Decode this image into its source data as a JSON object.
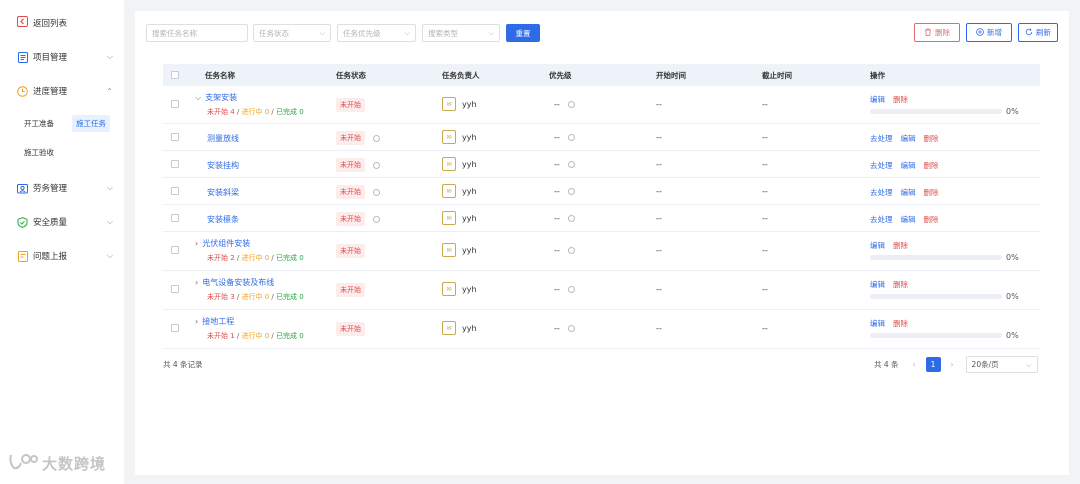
{
  "sidebar": {
    "back_label": "返回列表",
    "menus": [
      {
        "label": "项目管理",
        "icon": "document-icon"
      },
      {
        "label": "进度管理",
        "icon": "clock-icon"
      },
      {
        "label": "劳务管理",
        "icon": "worker-icon"
      },
      {
        "label": "安全质量",
        "icon": "shield-icon"
      },
      {
        "label": "问题上报",
        "icon": "report-icon"
      }
    ],
    "sub_items": [
      "开工准备",
      "施工任务",
      "施工验收"
    ]
  },
  "filters": {
    "name_placeholder": "搜索任务名称",
    "status_placeholder": "任务状态",
    "priority_placeholder": "任务优先级",
    "type_placeholder": "搜索类型",
    "reset_label": "重置"
  },
  "actions": {
    "delete_label": "删除",
    "add_label": "新增",
    "refresh_label": "刷新"
  },
  "table": {
    "headers": [
      "任务名称",
      "任务状态",
      "任务负责人",
      "优先级",
      "开始时间",
      "截止时间",
      "操作"
    ],
    "rows": [
      {
        "name": "支架安装",
        "parent": true,
        "expanded": true,
        "stats": {
          "not_started": "未开始 4",
          "in_progress": "进行中 0",
          "done": "已完成 0"
        },
        "status": "未开始",
        "owner": "yyh",
        "priority": "--",
        "start": "--",
        "end": "--",
        "ops": [
          "编辑",
          "删除"
        ],
        "progress": "0%"
      },
      {
        "name": "测量放线",
        "parent": false,
        "status": "未开始",
        "owner": "yyh",
        "priority": "--",
        "start": "--",
        "end": "--",
        "ops": [
          "去处理",
          "编辑",
          "删除"
        ]
      },
      {
        "name": "安装挂构",
        "parent": false,
        "status": "未开始",
        "owner": "yyh",
        "priority": "--",
        "start": "--",
        "end": "--",
        "ops": [
          "去处理",
          "编辑",
          "删除"
        ]
      },
      {
        "name": "安装斜梁",
        "parent": false,
        "status": "未开始",
        "owner": "yyh",
        "priority": "--",
        "start": "--",
        "end": "--",
        "ops": [
          "去处理",
          "编辑",
          "删除"
        ]
      },
      {
        "name": "安装檩条",
        "parent": false,
        "status": "未开始",
        "owner": "yyh",
        "priority": "--",
        "start": "--",
        "end": "--",
        "ops": [
          "去处理",
          "编辑",
          "删除"
        ]
      },
      {
        "name": "光伏组件安装",
        "parent": true,
        "expanded": false,
        "stats": {
          "not_started": "未开始 2",
          "in_progress": "进行中 0",
          "done": "已完成 0"
        },
        "status": "未开始",
        "owner": "yyh",
        "priority": "--",
        "start": "--",
        "end": "--",
        "ops": [
          "编辑",
          "删除"
        ],
        "progress": "0%"
      },
      {
        "name": "电气设备安装及布线",
        "parent": true,
        "expanded": false,
        "stats": {
          "not_started": "未开始 3",
          "in_progress": "进行中 0",
          "done": "已完成 0"
        },
        "status": "未开始",
        "owner": "yyh",
        "priority": "--",
        "start": "--",
        "end": "--",
        "ops": [
          "编辑",
          "删除"
        ],
        "progress": "0%"
      },
      {
        "name": "接地工程",
        "parent": true,
        "expanded": false,
        "stats": {
          "not_started": "未开始 1",
          "in_progress": "进行中 0",
          "done": "已完成 0"
        },
        "status": "未开始",
        "owner": "yyh",
        "priority": "--",
        "start": "--",
        "end": "--",
        "ops": [
          "编辑",
          "删除"
        ],
        "progress": "0%"
      }
    ]
  },
  "footer": {
    "records": "共 4 条记录",
    "total": "共 4 条",
    "current_page": "1",
    "page_size": "20条/页"
  },
  "watermark": "大数跨境",
  "colors": {
    "primary": "#2e6be6",
    "danger": "#e04b4b",
    "warning": "#f0a020",
    "success": "#28a745"
  }
}
